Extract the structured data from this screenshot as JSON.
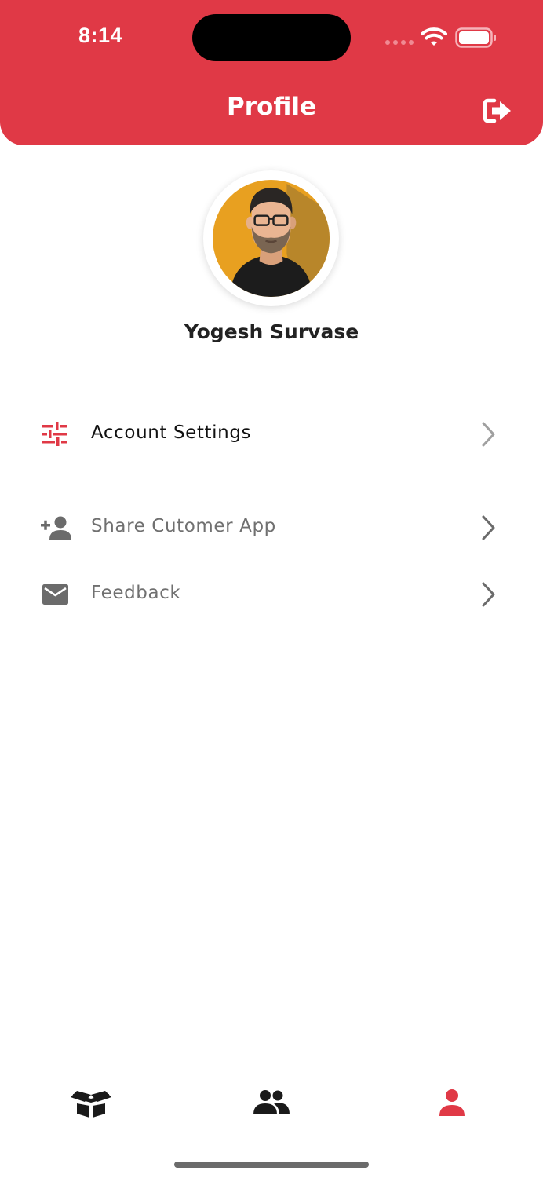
{
  "status_bar": {
    "time": "8:14"
  },
  "header": {
    "title": "Profile",
    "logout_icon": "logout-icon"
  },
  "profile": {
    "name": "Yogesh Survase",
    "avatar_icon": "avatar-illustration"
  },
  "menu": {
    "items": [
      {
        "label": "Account Settings",
        "icon": "tune-icon"
      },
      {
        "label": "Share Cutomer App",
        "icon": "person-add-icon"
      },
      {
        "label": "Feedback",
        "icon": "mail-icon"
      }
    ]
  },
  "bottom_nav": {
    "items": [
      {
        "icon": "box-icon",
        "active": false
      },
      {
        "icon": "people-icon",
        "active": false
      },
      {
        "icon": "person-icon",
        "active": true
      }
    ]
  },
  "colors": {
    "accent": "#e03946",
    "text_dark": "#111111",
    "text_gray": "#707070",
    "icon_gray": "#6b6b6b"
  }
}
